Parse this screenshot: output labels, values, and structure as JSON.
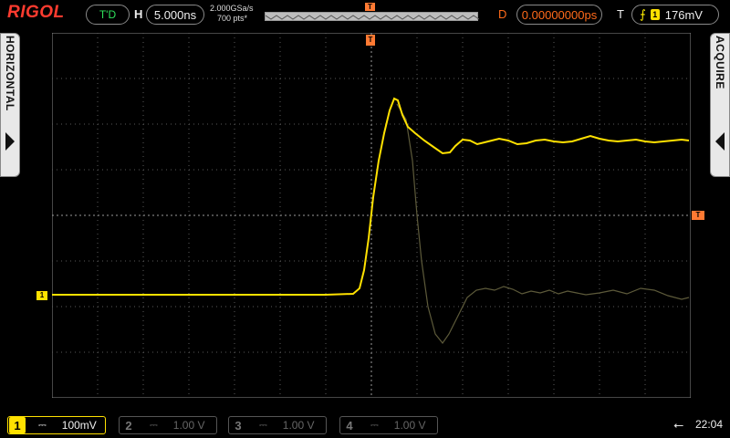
{
  "brand": "RIGOL",
  "status": "T'D",
  "horizontal": {
    "letter": "H",
    "timebase": "5.000ns",
    "sample_rate": "2.000GSa/s",
    "points": "700 pts*"
  },
  "delay": {
    "letter": "D",
    "value": "0.00000000ps"
  },
  "trigger": {
    "letter": "T",
    "source_badge": "1",
    "edge_icon": "rising-edge-icon",
    "level": "176mV",
    "marker": "T"
  },
  "side_panels": {
    "left": "HORIZONTAL",
    "right": "ACQUIRE"
  },
  "channels": [
    {
      "number": "1",
      "coupling": "⎓",
      "scale": "100mV",
      "active": true
    },
    {
      "number": "2",
      "coupling": "⎓",
      "scale": "1.00 V",
      "active": false
    },
    {
      "number": "3",
      "coupling": "⎓",
      "scale": "1.00 V",
      "active": false
    },
    {
      "number": "4",
      "coupling": "⎓",
      "scale": "1.00 V",
      "active": false
    }
  ],
  "ch1_marker": "1",
  "usb_icon": "usb-icon",
  "clock": "22:04",
  "colors": {
    "ch1": "#ffe100",
    "trigger": "#ff7a33",
    "status": "#2ee05a",
    "brand": "#ff3b2f",
    "grid": "#8c8c8c"
  }
}
